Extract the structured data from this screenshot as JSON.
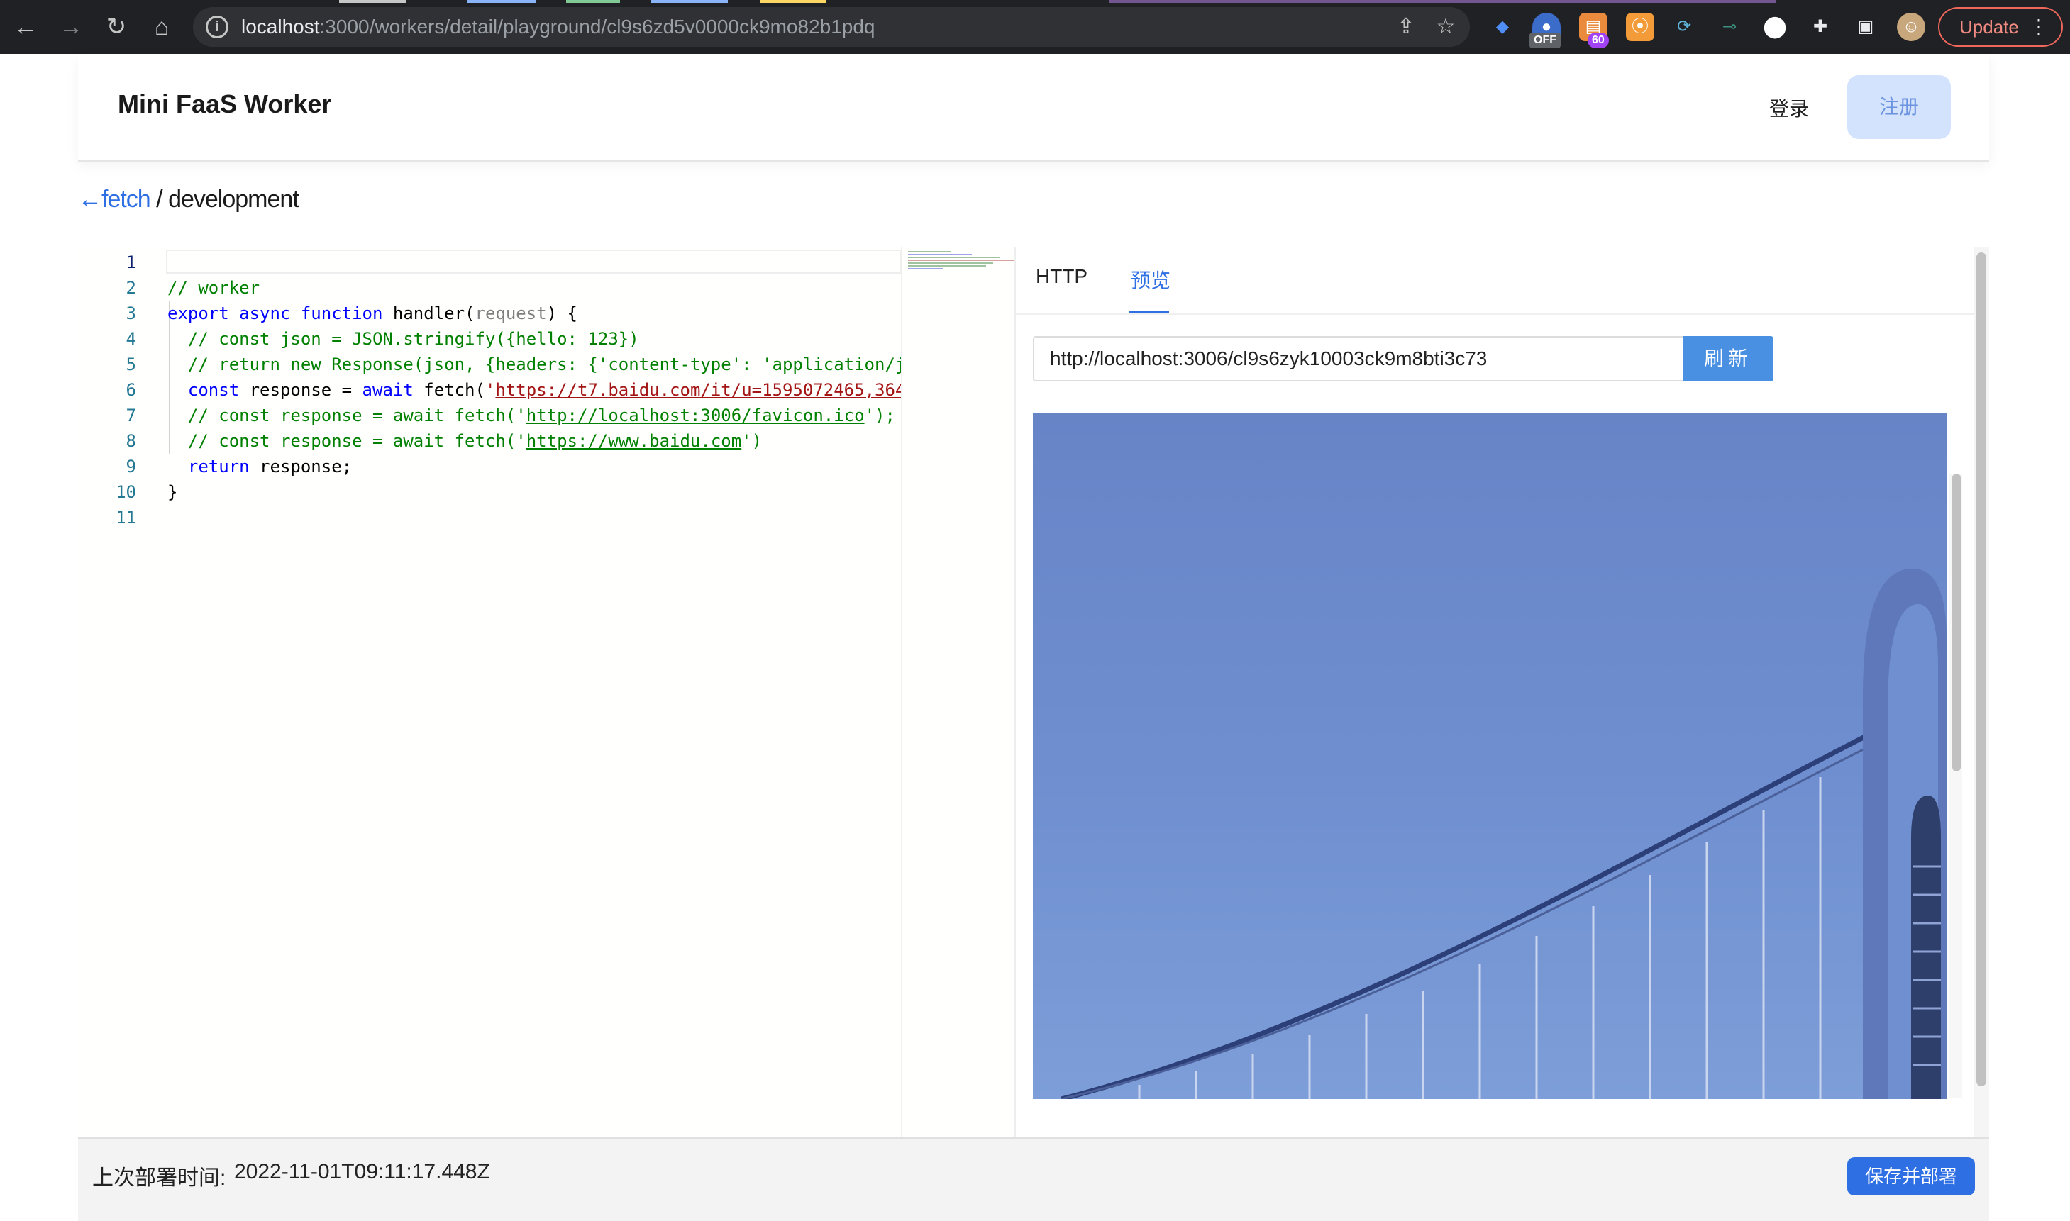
{
  "browser": {
    "url_host": "localhost",
    "url_path": ":3000/workers/detail/playground/cl9s6zd5v0000ck9mo82b1pdq",
    "update_label": "Update",
    "ext_badge_off": "OFF",
    "ext_badge_count": "60"
  },
  "header": {
    "brand": "Mini FaaS Worker",
    "login": "登录",
    "register": "注册"
  },
  "breadcrumb": {
    "back": "←fetch",
    "sep": "/",
    "env": "development"
  },
  "editor": {
    "line_numbers": [
      "1",
      "2",
      "3",
      "4",
      "5",
      "6",
      "7",
      "8",
      "9",
      "10",
      "11"
    ],
    "line2": "// worker",
    "line3": {
      "export": "export",
      "async": "async",
      "function": "function",
      "name": " handler(",
      "param": "request",
      "close": ") {"
    },
    "line4": "  // const json = JSON.stringify({hello: 123})",
    "line5": "  // return new Response(json, {headers: {'content-type': 'application/j",
    "line6": {
      "const": "const",
      "mid": " response = ",
      "await": "await",
      "call": " fetch(",
      "q": "'",
      "link": "https://t7.baidu.com/it/u=1595072465,364"
    },
    "line7": {
      "pre": "  // const response = await fetch('",
      "link": "http://localhost:3006/favicon.ico",
      "post": "');"
    },
    "line8": {
      "pre": "  // const response = await fetch('",
      "link": "https://www.baidu.com",
      "post": "')"
    },
    "line9": {
      "return": "return",
      "rest": " response;"
    },
    "line10": "}"
  },
  "panel": {
    "tab_http": "HTTP",
    "tab_preview": "预览",
    "url_value": "http://localhost:3006/cl9s6zyk10003ck9m8bti3c73",
    "refresh": "刷新"
  },
  "footer": {
    "deploy_label": "上次部署时间:",
    "deploy_time": "2022-11-01T09:11:17.448Z",
    "save": "保存并部署"
  },
  "colors": {
    "accent": "#2f6fe4",
    "chrome_bg": "#202124"
  }
}
